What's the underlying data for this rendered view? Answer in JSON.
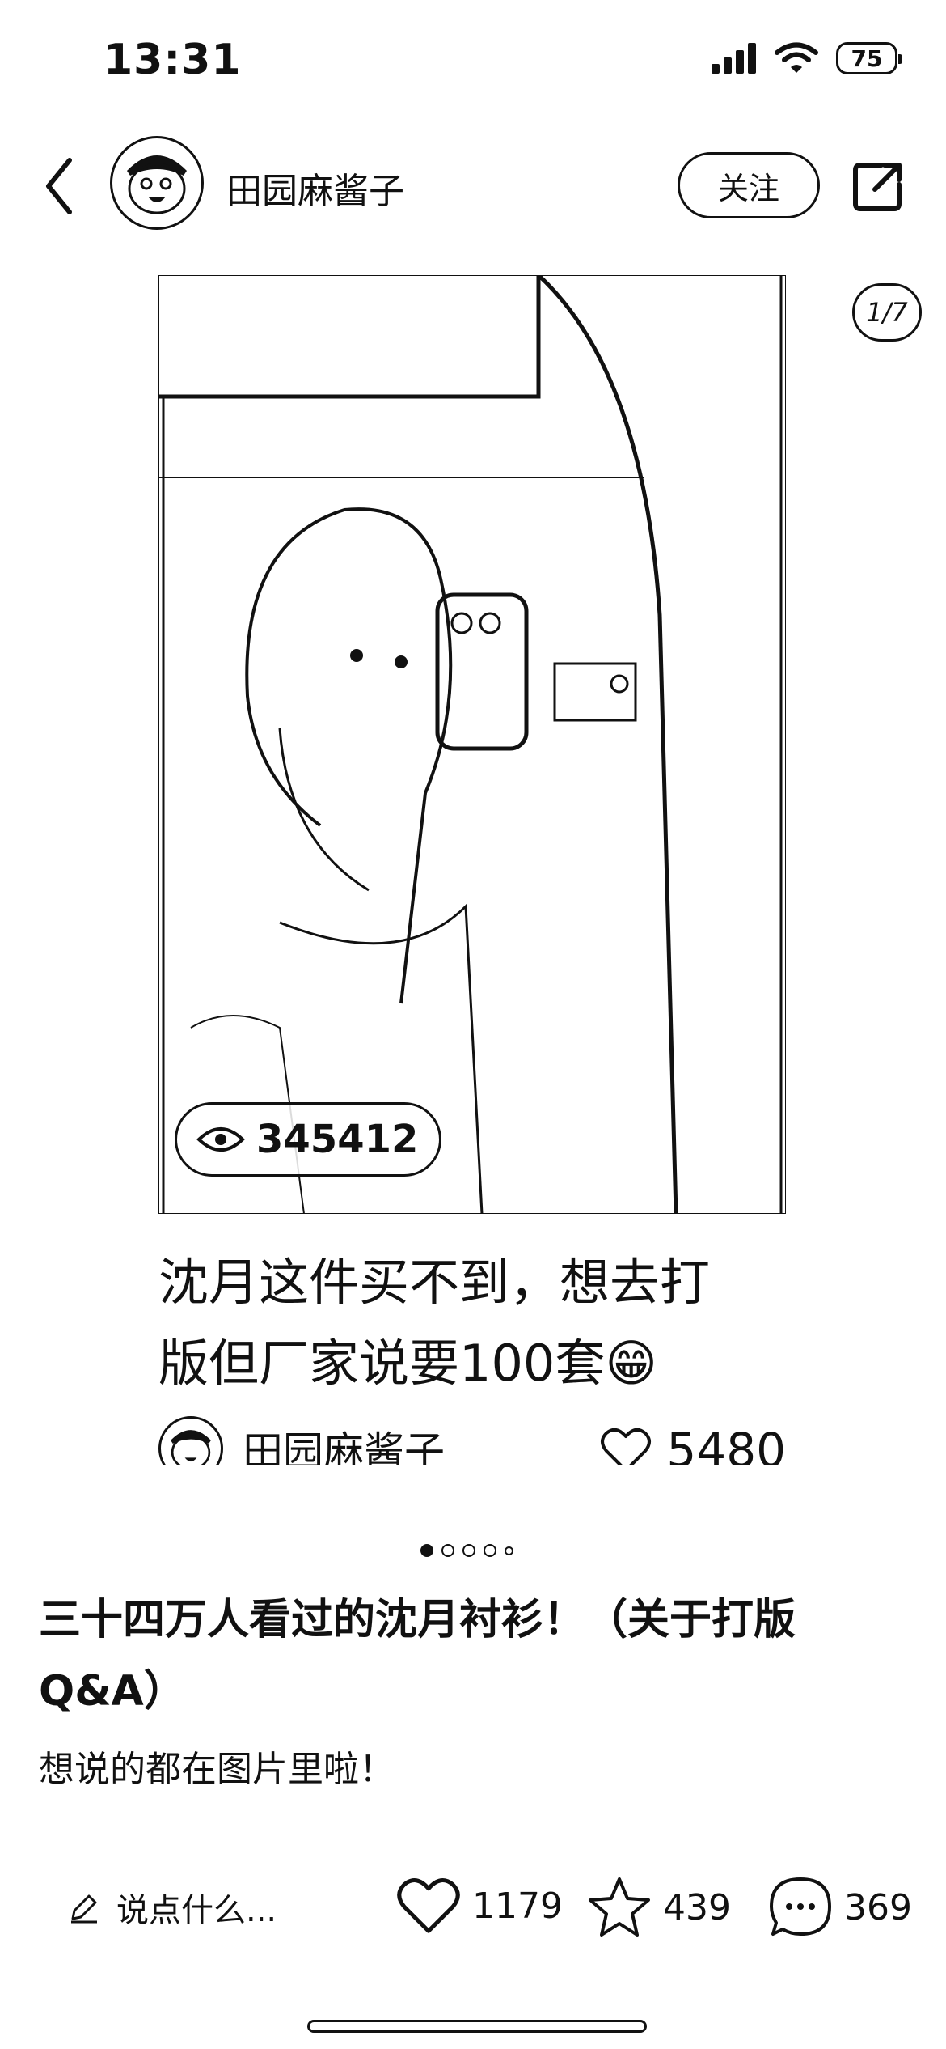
{
  "status_bar": {
    "time": "13:31",
    "battery": "75"
  },
  "header": {
    "author_name": "田园麻酱子",
    "follow_label": "关注"
  },
  "image_counter": "1/7",
  "post_card": {
    "views": "345412",
    "title_line1": "沈月这件买不到，想去打",
    "title_line2": "版但厂家说要100套😁",
    "author_name": "田园麻酱子",
    "likes": "5480"
  },
  "pagination": {
    "total_visible": 5,
    "active_index": 0
  },
  "note": {
    "title": "三十四万人看过的沈月衬衫！（关于打版Q&A）",
    "body": "想说的都在图片里啦！"
  },
  "bottom_bar": {
    "comment_placeholder": "说点什么...",
    "likes": "1179",
    "favorites": "439",
    "comments": "369"
  }
}
